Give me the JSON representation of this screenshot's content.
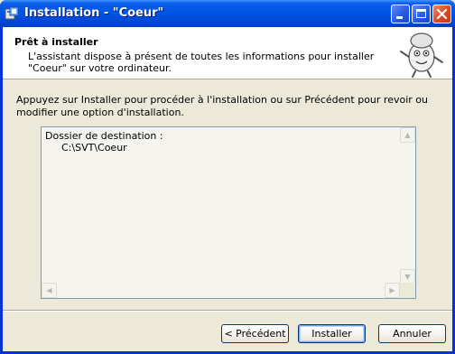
{
  "window": {
    "title": "Installation - \"Coeur\"",
    "controls": {
      "minimize": "minimize-icon",
      "maximize": "maximize-icon",
      "close": "close-icon"
    }
  },
  "header": {
    "title": "Prêt à installer",
    "subtitle": "L'assistant dispose à présent de toutes les informations pour installer \"Coeur\" sur votre ordinateur."
  },
  "main": {
    "intro": "Appuyez sur Installer pour procéder à l'installation ou sur Précédent pour revoir ou modifier une option d'installation.",
    "summary": {
      "label": "Dossier de destination :",
      "path": "C:\\SVT\\Coeur"
    }
  },
  "buttons": {
    "back": "< Précédent",
    "install": "Installer",
    "cancel": "Annuler"
  },
  "colors": {
    "titlebar": "#0055e5",
    "dialog_bg": "#ece9d8",
    "button_border": "#003c74"
  }
}
